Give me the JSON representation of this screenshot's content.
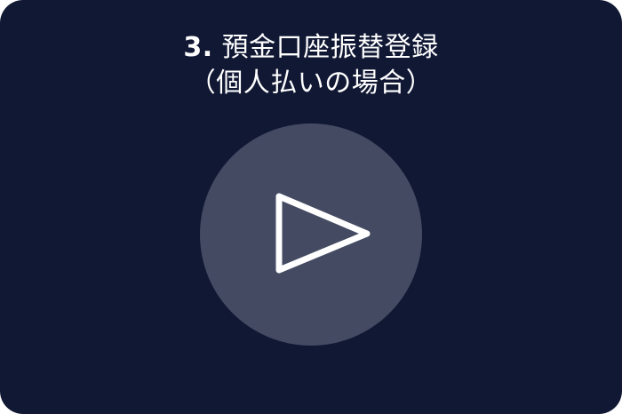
{
  "card": {
    "title_number": "3.",
    "title_line1": "預金口座振替登録",
    "title_line2": "（個人払いの場合）"
  },
  "colors": {
    "card_background": "#111834",
    "play_circle": "#434a62",
    "play_icon": "#ffffff",
    "title_text": "#ffffff"
  },
  "play_button": {
    "icon": "play-icon"
  }
}
